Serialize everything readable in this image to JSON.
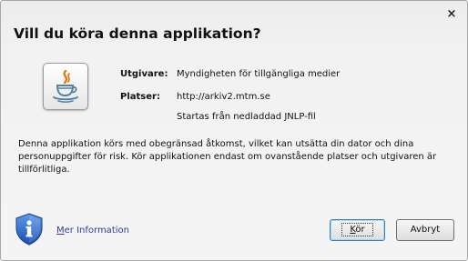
{
  "dialog": {
    "title": "Vill du köra denna applikation?",
    "close_glyph": "×"
  },
  "details": {
    "publisher_label": "Utgivare:",
    "publisher_value": "Myndigheten för tillgängliga medier",
    "location_label": "Platser:",
    "location_value": "http://arkiv2.mtm.se",
    "launch_note": "Startas från nedladdad JNLP-fil"
  },
  "warning_text": "Denna applikation körs med obegränsad åtkomst, vilket kan utsätta din dator och dina personuppgifter för risk. Kör applikationen endast om ovanstående platser och utgivaren är tillförlitliga.",
  "footer": {
    "more_info_prefix": "M",
    "more_info_rest": "er Information",
    "run_prefix": "K",
    "run_rest": "ör",
    "cancel_label": "Avbryt"
  },
  "icons": {
    "app": "java-cup-icon",
    "info": "info-shield-icon",
    "close": "close-icon"
  },
  "colors": {
    "link": "#2a3f9a",
    "java_orange": "#e76f00",
    "java_blue": "#5382a1",
    "shield_blue": "#1f5fbf"
  }
}
